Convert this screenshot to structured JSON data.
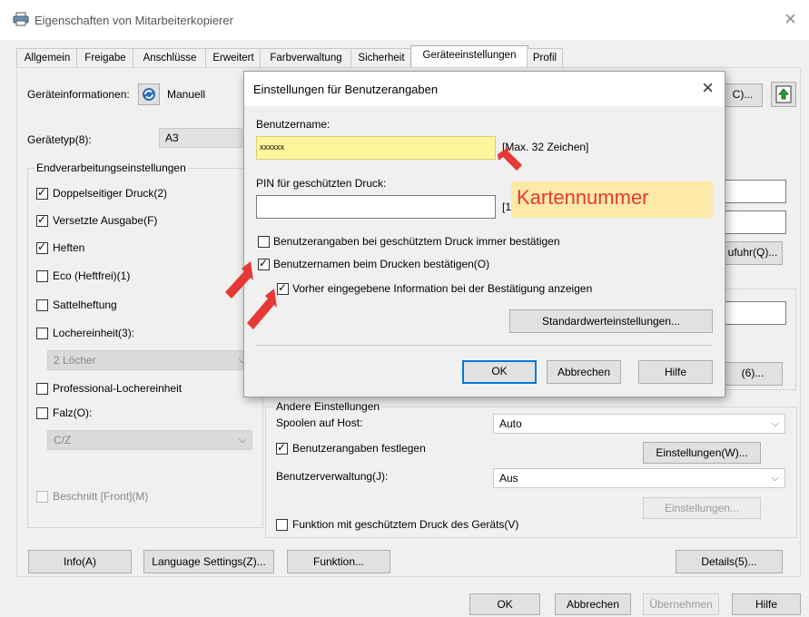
{
  "window": {
    "title": "Eigenschaften von Mitarbeiterkopierer",
    "close": "×"
  },
  "tabs": [
    "Allgemein",
    "Freigabe",
    "Anschlüsse",
    "Erweitert",
    "Farbverwaltung",
    "Sicherheit",
    "Geräteeinstellungen",
    "Profil"
  ],
  "device": {
    "info_label": "Geräteinformationen:",
    "mode": "Manuell",
    "type_label": "Gerätetyp(8):",
    "type_value": "A3",
    "right_button_fragment": "C)..."
  },
  "finishing": {
    "group_label": "Endverarbeitungseinstellungen",
    "duplex": "Doppelseitiger Druck(2)",
    "offset": "Versetzte Ausgabe(F)",
    "staple": "Heften",
    "eco": "Eco (Heftfrei)(1)",
    "saddle": "Sattelheftung",
    "punch": "Lochereinheit(3):",
    "punch_value": "2 Löcher",
    "pro_punch": "Professional-Lochereinheit",
    "fold": "Falz(O):",
    "fold_value": "C/Z",
    "trim": "Beschnitt [Front](M)"
  },
  "right_fragments": {
    "feed": "ufuhr(Q)...",
    "six": "(6)..."
  },
  "other": {
    "group_label": "Andere Einstellungen",
    "spool_label": "Spoolen auf Host:",
    "spool_value": "Auto",
    "user_info": "Benutzerangaben festlegen",
    "settings_w": "Einstellungen(W)...",
    "user_mgmt_label": "Benutzerverwaltung(J):",
    "user_mgmt_value": "Aus",
    "settings_disabled": "Einstellungen...",
    "secure_func": "Funktion mit geschütztem Druck des Geräts(V)"
  },
  "bottom_buttons": {
    "info": "Info(A)",
    "language": "Language Settings(Z)...",
    "function": "Funktion...",
    "details": "Details(5)..."
  },
  "footer": {
    "ok": "OK",
    "cancel": "Abbrechen",
    "apply": "Übernehmen",
    "help": "Hilfe"
  },
  "dialog": {
    "title": "Einstellungen für Benutzerangaben",
    "close": "×",
    "username_label": "Benutzername:",
    "username_value": "xxxxxx",
    "username_hint": "[Max. 32 Zeichen]",
    "pin_label": "PIN für geschützten Druck:",
    "pin_hint": "[1",
    "annotation": "Kartennummer",
    "cb_always_confirm": "Benutzerangaben bei geschütztem Druck immer bestätigen",
    "cb_confirm_name": "Benutzernamen beim Drucken bestätigen(O)",
    "cb_show_previous": "Vorher eingegebene Information bei der Bestätigung anzeigen",
    "defaults_button": "Standardwerteinstellungen...",
    "ok": "OK",
    "cancel": "Abbrechen",
    "help": "Hilfe"
  },
  "colors": {
    "highlight": "#fff59d",
    "annotation_bg": "#fde9a8",
    "annotation_text": "#e53935",
    "arrow": "#e53935",
    "accent": "#0078d7"
  }
}
